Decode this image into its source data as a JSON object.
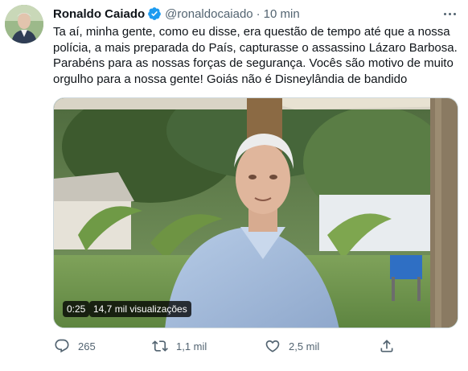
{
  "tweet": {
    "author_name": "Ronaldo Caiado",
    "handle": "@ronaldocaiado",
    "separator": "·",
    "time": "10 min",
    "text_lines": [
      "Ta aí, minha gente, como eu disse, era questão de tempo até que a nossa",
      "polícia, a mais preparada do País, capturasse o assassino Lázaro Barbosa.",
      "Parabéns para as nossas forças de segurança. Vocês são motivo de muito",
      "orgulho para a nossa gente! Goiás não é Disneylândia de bandido"
    ],
    "video": {
      "duration": "0:25",
      "views": "14,7 mil visualizações"
    },
    "actions": {
      "replies": "265",
      "retweets": "1,1 mil",
      "likes": "2,5 mil"
    },
    "icons": {
      "verified": "verified-badge-icon",
      "more": "more-icon",
      "reply": "reply-icon",
      "retweet": "retweet-icon",
      "like": "heart-icon",
      "share": "share-icon"
    },
    "colors": {
      "verified": "#1d9bf0",
      "text": "#0f1419",
      "secondary": "#536471"
    }
  }
}
